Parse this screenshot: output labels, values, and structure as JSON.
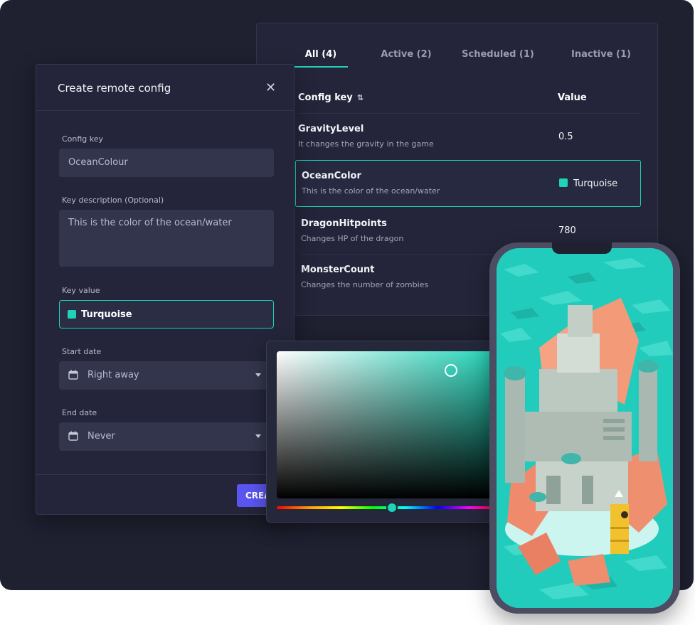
{
  "colors": {
    "accent": "#1ed3b7",
    "primary_button": "#5a55f0",
    "panel": "#24253a",
    "background": "#1f2030"
  },
  "tabs": [
    {
      "label": "All (4)",
      "active": true
    },
    {
      "label": "Active (2)",
      "active": false
    },
    {
      "label": "Scheduled (1)",
      "active": false
    },
    {
      "label": "Inactive (1)",
      "active": false
    }
  ],
  "table": {
    "col_key": "Config key",
    "col_value": "Value",
    "rows": [
      {
        "key": "GravityLevel",
        "desc": "It changes the gravity in the game",
        "value": "0.5"
      },
      {
        "key": "OceanColor",
        "desc": "This is the color of the ocean/water",
        "value": "Turquoise",
        "selected": true
      },
      {
        "key": "DragonHitpoints",
        "desc": "Changes HP of the dragon",
        "value": "780"
      },
      {
        "key": "MonsterCount",
        "desc": "Changes the number of zombies",
        "value": ""
      }
    ]
  },
  "modal": {
    "title": "Create remote config",
    "config_key_label": "Config key",
    "config_key_value": "OceanColour",
    "desc_label": "Key description (Optional)",
    "desc_value": "This is the color of the ocean/water",
    "key_value_label": "Key value",
    "key_value": "Turquoise",
    "start_label": "Start date",
    "start_value": "Right away",
    "end_label": "End date",
    "end_value": "Never",
    "create_label": "CREA"
  },
  "icons": [
    "close-icon",
    "sort-icon",
    "calendar-icon",
    "caret-down-icon"
  ],
  "picker": {
    "hue_deg": 172,
    "saturation": 0.82,
    "brightness": 0.9
  }
}
